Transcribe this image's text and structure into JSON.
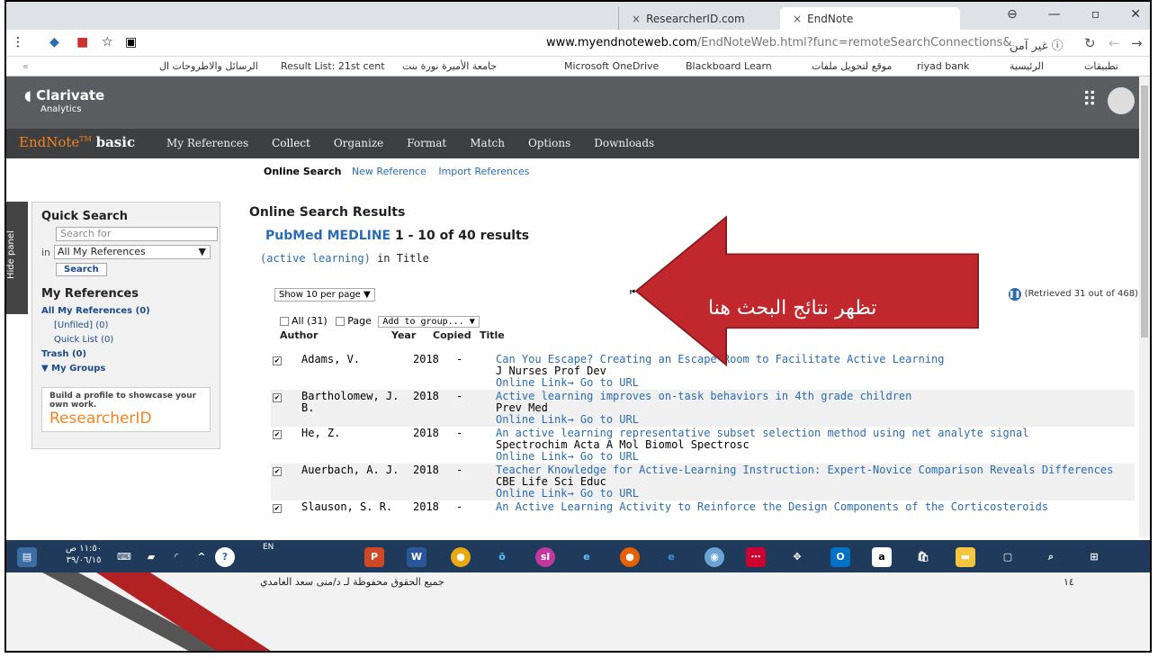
{
  "browser": {
    "tabs": [
      {
        "label": "ResearcherID.com"
      },
      {
        "label": "EndNote"
      }
    ],
    "url_domain": "www.myendnoteweb.com",
    "url_path": "/EndNoteWeb.html?func=remoteSearchConnections&",
    "security_label": "غير آمن",
    "bookmarks": [
      "تطبيقات",
      "الرئيسية",
      "riyad bank",
      "موقع لتحويل ملفات",
      "Blackboard Learn",
      "Microsoft OneDrive",
      "جامعة الأميرة نورة بنت",
      "Result List: 21st cent",
      "الرسائل والاطروحات ال"
    ]
  },
  "header": {
    "brand": "Clarivate",
    "brand_sub": "Analytics"
  },
  "endnote": {
    "brand": "EndNote",
    "tm": "TM",
    "edition": "basic",
    "menu": [
      "My References",
      "Collect",
      "Organize",
      "Format",
      "Match",
      "Options",
      "Downloads"
    ],
    "subnav_active": "Online Search",
    "subnav": [
      "New Reference",
      "Import References"
    ]
  },
  "sidebar": {
    "hide_panel": "Hide panel",
    "quick_search_title": "Quick Search",
    "search_placeholder": "Search for",
    "in_label": "in",
    "scope": "All My References",
    "search_button": "Search",
    "my_refs_title": "My References",
    "links": [
      "All My References (0)",
      "[Unfiled] (0)",
      "Quick List (0)",
      "Trash (0)",
      "▼ My Groups"
    ],
    "rid_promo": "Build a profile to showcase your own work.",
    "rid_brand": "ResearcherID"
  },
  "results": {
    "title": "Online Search Results",
    "db": "PubMed MEDLINE",
    "range": "1 - 10 of 40 results",
    "query": "(active learning)",
    "query_in": "in Title",
    "per_page": "Show 10 per page ▼",
    "page_label": "Pa",
    "retrieved": "(Retrieved 31 out of 468)",
    "all_label": "All (31)",
    "page_cb": "Page",
    "add_group": "Add to group... ▼",
    "columns": [
      "Author",
      "Year",
      "Copied",
      "Title"
    ],
    "rows": [
      {
        "author": "Adams, V.",
        "year": "2018",
        "copied": "-",
        "title": "Can You Escape? Creating an Escape Room to Facilitate Active Learning",
        "journal": "J Nurses Prof Dev",
        "link": "Online Link→ Go to URL"
      },
      {
        "author": "Bartholomew, J. B.",
        "year": "2018",
        "copied": "-",
        "title": "Active learning improves on-task behaviors in 4th grade children",
        "journal": "Prev Med",
        "link": "Online Link→ Go to URL"
      },
      {
        "author": "He, Z.",
        "year": "2018",
        "copied": "-",
        "title": "An active learning representative subset selection method using net analyte signal",
        "journal": "Spectrochim Acta A Mol Biomol Spectrosc",
        "link": "Online Link→ Go to URL"
      },
      {
        "author": "Auerbach, A. J.",
        "year": "2018",
        "copied": "-",
        "title": "Teacher Knowledge for Active-Learning Instruction: Expert-Novice Comparison Reveals Differences",
        "journal": "CBE Life Sci Educ",
        "link": "Online Link→ Go to URL"
      },
      {
        "author": "Slauson, S. R.",
        "year": "2018",
        "copied": "-",
        "title": "An Active Learning Activity to Reinforce the Design Components of the Corticosteroids",
        "journal": "",
        "link": ""
      }
    ]
  },
  "annotation": {
    "text": "تظهر نتائج البحث هنا",
    "color": "#c0282d"
  },
  "taskbar": {
    "time": "١١:٥٠ ص",
    "date": "٣٩/٠٦/١٥",
    "lang": "EN"
  },
  "footer": {
    "copyright": "جميع الحقوق محفوظة لـ د/منى سعد الغامدي",
    "page": "١٤"
  }
}
